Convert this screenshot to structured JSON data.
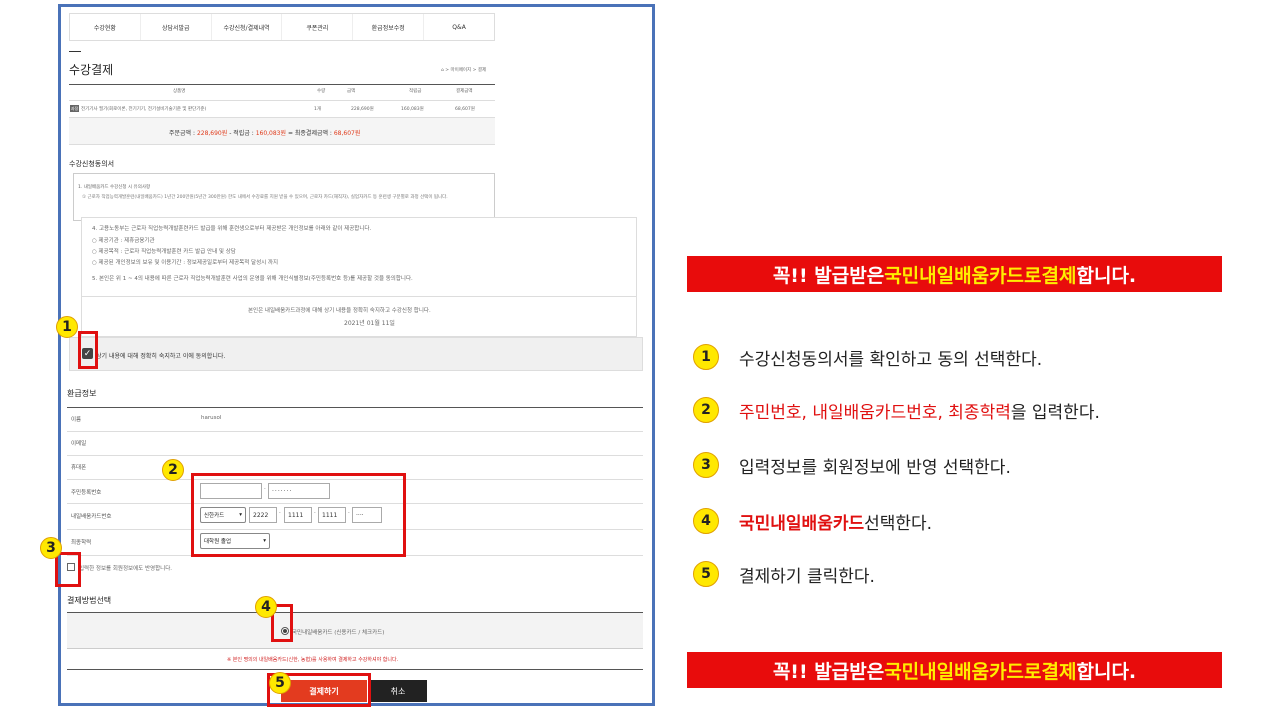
{
  "tabs": [
    "수강현황",
    "상담서발급",
    "수강신청/결제내역",
    "쿠폰관리",
    "환급정보수정",
    "Q&A"
  ],
  "page_title": "수강결제",
  "breadcrumb": "⌂ > 마이페이지 > 결제",
  "order_table": {
    "headers": [
      "상품명",
      "수량",
      "금액",
      "적립금",
      "결제금액"
    ],
    "row": {
      "tag": "과정",
      "name": "전기기사 필기(회로이론, 전기기기, 전기설비기술기준 및 판단기준)",
      "qty": "1개",
      "price": "228,690원",
      "points": "160,083원",
      "pay": "68,607원"
    },
    "summary": {
      "order_label": "주문금액 :",
      "order_value": "228,690원",
      "points_label": "- 적립금 :",
      "points_value": "160,083원",
      "final_label": "= 최종결제금액 :",
      "final_value": "68,607원"
    }
  },
  "consent": {
    "title": "수강신청동의서",
    "box_heading": "1. 내일배움카드 수강신청 시 유의사항",
    "box_text": "① 근로자 직업능력개발훈련(내일배움카드) 1년간 200만원(5년간 300만원) 한도 내에서 수강료를 지원 받을 수 있으며, 근로자 카드(재직자), 실업자카드 등 훈련생 구분별로 과정 선택이 됩니다.",
    "lines": [
      "4. 고용노동부는 근로자 직업능력개발훈련카드 발급을 위해 훈련생으로부터 제공받은 개인정보를 아래와 같이 제공합니다.",
      "○ 제공기관 : 제휴금융기관",
      "○ 제공목적 : 근로자 직업능력개발훈련 카드 발급 안내 및 상담",
      "○ 제공된 개인정보의 보유 및 이용기간 : 정보제공일로부터 제공목적 달성시 까지",
      "5. 본인은 위 1 ~ 4의 내용에 따른 근로자 직업능력개발훈련 사업의 운영을 위해 개인식별정보(주민등록번호 등)를 제공할 것을 동의합니다."
    ],
    "confirm_line": "본인은 내일배움카드과정에 대해 상기 내용을 정확히 숙지하고 수강신청 합니다.",
    "date": "2021년 01월 11일",
    "agree_label": "상기 내용에 대해 정확히 숙지하고 이에 동의합니다."
  },
  "refund": {
    "title": "환급정보",
    "name_label": "이름",
    "name_value": "harusol",
    "email_label": "이메일",
    "phone_label": "휴대폰",
    "rrn_label": "주민등록번호",
    "rrn_back": "·······",
    "card_label": "내일배움카드번호",
    "card_type": "신한카드",
    "card_parts": [
      "2222",
      "1111",
      "1111",
      "····"
    ],
    "edu_label": "최종학력",
    "edu_value": "대학원 졸업",
    "reflect_label": "입력한 정보를 회원정보에도 반영합니다."
  },
  "payment": {
    "title": "결제방법선택",
    "option": "국민내일배움카드 (신용카드 / 체크카드)",
    "warning": "※ 본인 명의의 내일배움카드(신한, 농협)를 사용하여 결제하고 수강하셔야 합니다.",
    "pay_button": "결제하기",
    "cancel_button": "취소"
  },
  "badges": [
    "1",
    "2",
    "3",
    "4",
    "5"
  ],
  "banner": {
    "part1": "꼭!! 발급받은 ",
    "part2": "국민내일배움카드로",
    "part3": " ",
    "part4": "결제",
    "part5": " 합니다."
  },
  "steps": [
    {
      "num": "1",
      "text": "수강신청동의서를 확인하고 동의 선택한다."
    },
    {
      "num": "2",
      "red": "주민번호, 내일배움카드번호, 최종학력",
      "text": "을 입력한다."
    },
    {
      "num": "3",
      "text": "입력정보를 회원정보에 반영 선택한다."
    },
    {
      "num": "4",
      "red": "국민내일배움카드",
      "text": " 선택한다."
    },
    {
      "num": "5",
      "text": "결제하기 클릭한다."
    }
  ],
  "colors": {
    "frame": "#4a72b8",
    "highlight": "#e01010",
    "badge": "#ffe800",
    "accent": "#e03a1a"
  }
}
